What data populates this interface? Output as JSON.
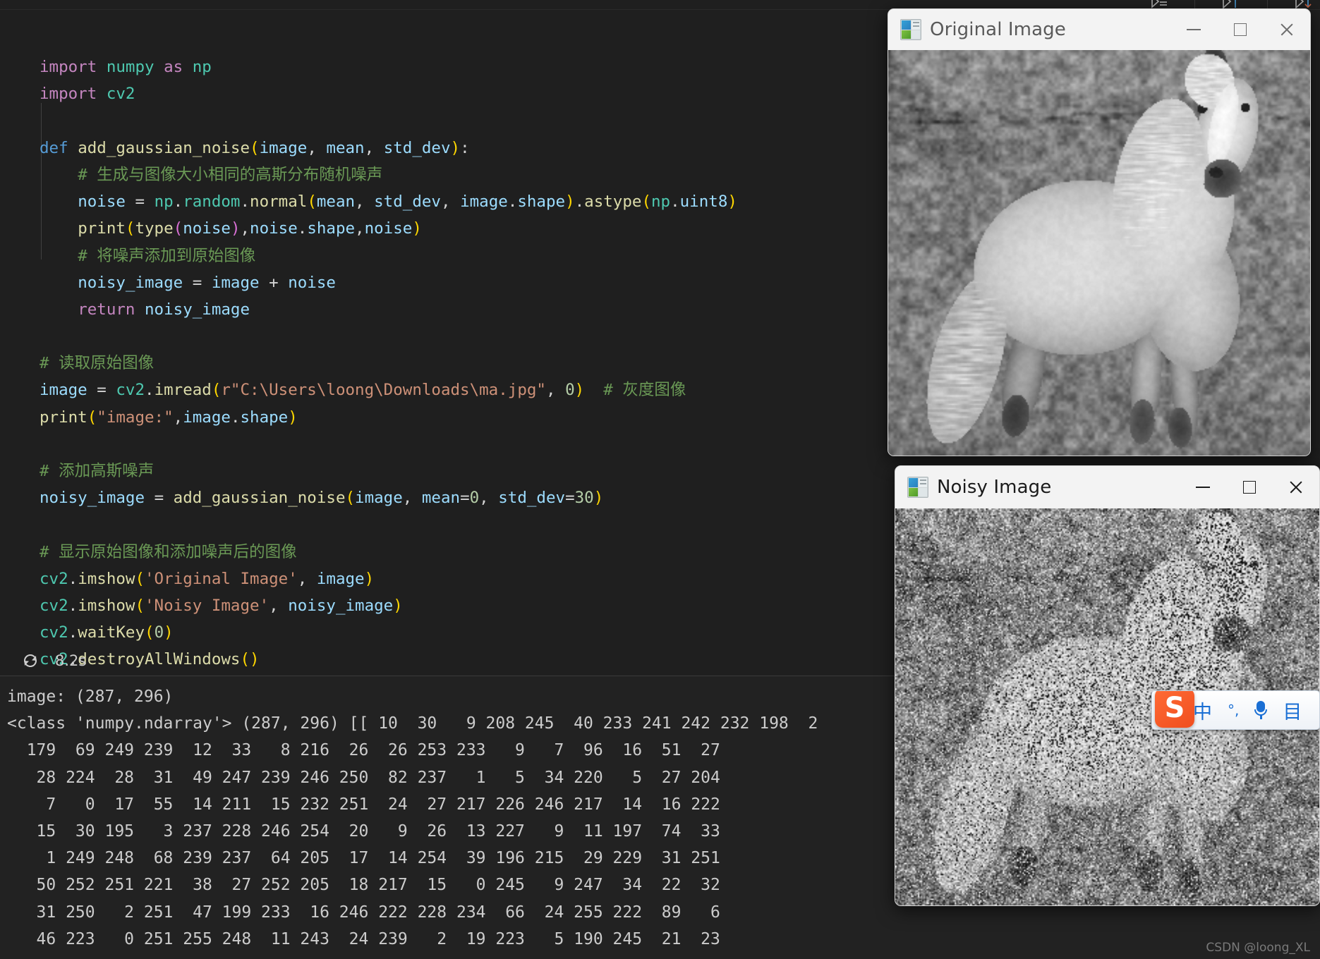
{
  "editor": {
    "cell_execution_time": "8.2s",
    "execution_icon": "restart-circle-icon",
    "code_lines": [
      "import numpy as np",
      "import cv2",
      "",
      "def add_gaussian_noise(image, mean, std_dev):",
      "    # 生成与图像大小相同的高斯分布随机噪声",
      "    noise = np.random.normal(mean, std_dev, image.shape).astype(np.uint8)",
      "    print(type(noise),noise.shape,noise)",
      "    # 将噪声添加到原始图像",
      "    noisy_image = image + noise",
      "    return noisy_image",
      "",
      "# 读取原始图像",
      "image = cv2.imread(r\"C:\\Users\\loong\\Downloads\\ma.jpg\", 0)  # 灰度图像",
      "print(\"image:\",image.shape)",
      "",
      "# 添加高斯噪声",
      "noisy_image = add_gaussian_noise(image, mean=0, std_dev=30)",
      "",
      "# 显示原始图像和添加噪声后的图像",
      "cv2.imshow('Original Image', image)",
      "cv2.imshow('Noisy Image', noisy_image)",
      "cv2.waitKey(0)",
      "cv2.destroyAllWindows()"
    ]
  },
  "toolbar": {
    "icons": [
      {
        "name": "run-all-icon",
        "label": "Run All"
      },
      {
        "name": "restart-kernel-icon",
        "label": "Restart"
      },
      {
        "name": "interrupt-kernel-icon",
        "label": "Interrupt"
      }
    ]
  },
  "output": {
    "lines": [
      "image: (287, 296)",
      "<class 'numpy.ndarray'> (287, 296) [[ 10  30   9 208 245  40 233 241 242 232 198  2",
      "  179  69 249 239  12  33   8 216  26  26 253 233   9   7  96  16  51  27",
      "   28 224  28  31  49 247 239 246 250  82 237   1   5  34 220   5  27 204",
      "    7   0  17  55  14 211  15 232 251  24  27 217 226 246 217  14  16 222",
      "   15  30 195   3 237 228 246 254  20   9  26  13 227   9  11 197  74  33",
      "    1 249 248  68 239 237  64 205  17  14 254  39 196 215  29 229  31 251",
      "   50 252 251 221  38  27 252 205  18 217  15   0 245   9 247  34  22  32",
      "   31 250   2 251  47 199 233  16 246 222 228 234  66  24 255 222  89   6",
      "   46 223   0 251 255 248  11 243  24 239   2  19 223   5 190 245  21  23"
    ],
    "watermark": "CSDN @loong_XL"
  },
  "windows": {
    "original": {
      "title": "Original Image",
      "icon": "opencv-window-icon",
      "minimize": "minimize-button",
      "maximize": "maximize-button",
      "close": "close-button"
    },
    "noisy": {
      "title": "Noisy Image",
      "icon": "opencv-window-icon",
      "minimize": "minimize-button",
      "maximize": "maximize-button",
      "close": "close-button"
    }
  },
  "ime": {
    "logo": "S",
    "mode": "中",
    "punctuation": "°,",
    "voice_icon": "microphone-icon",
    "menu": "目"
  },
  "colors": {
    "editor_bg": "#1f1f1f",
    "output_bg": "#222222",
    "titlebar_bg": "#f3f3f3",
    "comment": "#6A9955",
    "string": "#CE9178",
    "keyword": "#C586C0",
    "function": "#DCDCAA",
    "variable": "#9CDCFE",
    "ime_accent": "#1a6fd4",
    "sogou_orange": "#f04e1f"
  }
}
